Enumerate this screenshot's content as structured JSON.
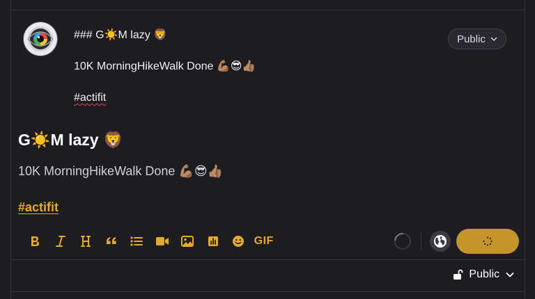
{
  "editor": {
    "line1": "### G☀️M lazy 🦁",
    "line2": "10K MorningHikeWalk Done 💪🏽😎👍🏽",
    "line3": "#actifit"
  },
  "audience_select": {
    "label": "Public"
  },
  "preview": {
    "title": "G☀️M lazy 🦁",
    "body": "10K MorningHikeWalk Done 💪🏽😎👍🏽",
    "tag": "#actifit"
  },
  "toolbar": {
    "gif_label": "GIF",
    "tools": [
      "bold-icon",
      "italic-icon",
      "heading-icon",
      "quote-icon",
      "list-icon",
      "video-icon",
      "image-icon",
      "poll-icon",
      "emoji-icon",
      "gif-icon"
    ]
  },
  "footer": {
    "visibility_label": "Public"
  },
  "colors": {
    "accent": "#e5aa2e",
    "post_button": "#c5952a",
    "background": "#1d1c21"
  }
}
